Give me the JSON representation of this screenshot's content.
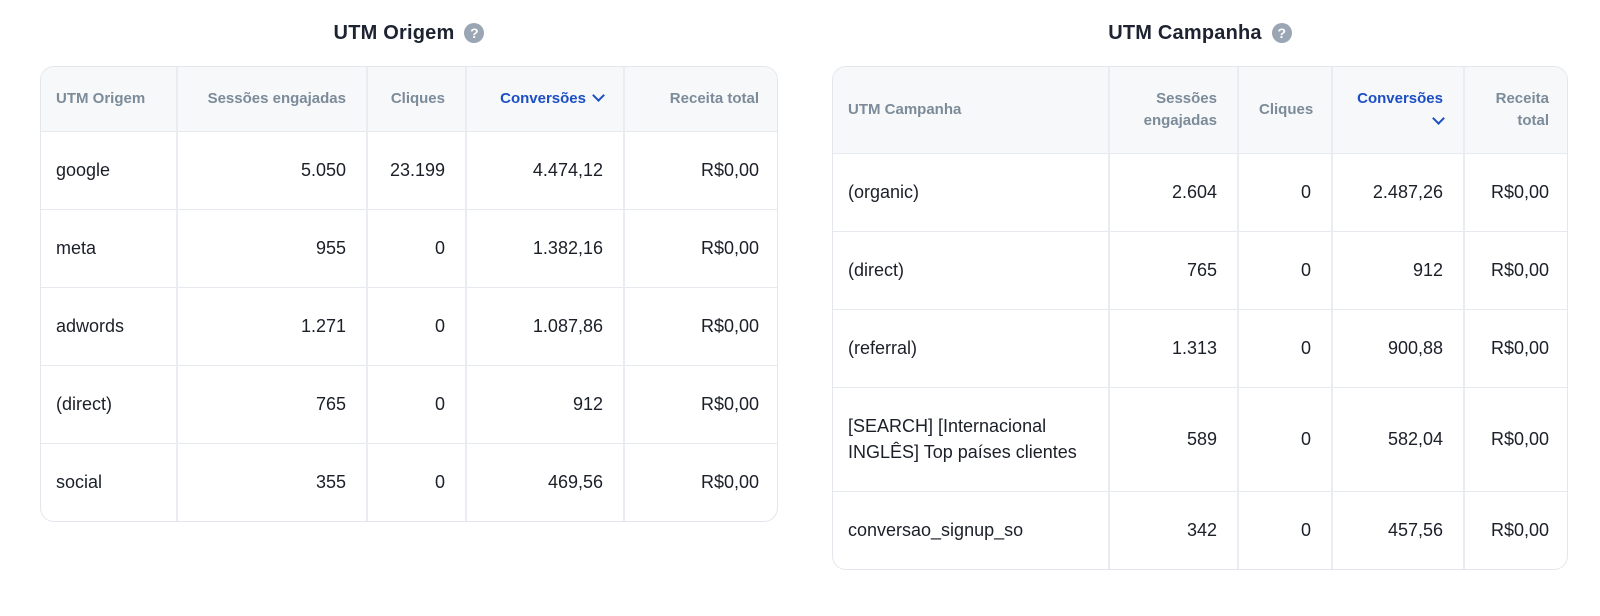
{
  "origem": {
    "title": "UTM Origem",
    "help_glyph": "?",
    "columns": [
      "UTM Origem",
      "Sessões engajadas",
      "Cliques",
      "Conversões",
      "Receita total"
    ],
    "rows": [
      [
        "google",
        "5.050",
        "23.199",
        "4.474,12",
        "R$0,00"
      ],
      [
        "meta",
        "955",
        "0",
        "1.382,16",
        "R$0,00"
      ],
      [
        "adwords",
        "1.271",
        "0",
        "1.087,86",
        "R$0,00"
      ],
      [
        "(direct)",
        "765",
        "0",
        "912",
        "R$0,00"
      ],
      [
        "social",
        "355",
        "0",
        "469,56",
        "R$0,00"
      ]
    ]
  },
  "campanha": {
    "title": "UTM Campanha",
    "help_glyph": "?",
    "columns": [
      "UTM Campanha",
      "Sessões engajadas",
      "Cliques",
      "Conversões",
      "Receita total"
    ],
    "rows": [
      [
        "(organic)",
        "2.604",
        "0",
        "2.487,26",
        "R$0,00"
      ],
      [
        "(direct)",
        "765",
        "0",
        "912",
        "R$0,00"
      ],
      [
        "(referral)",
        "1.313",
        "0",
        "900,88",
        "R$0,00"
      ],
      [
        "[SEARCH] [Internacional INGLÊS] Top países clientes",
        "589",
        "0",
        "582,04",
        "R$0,00"
      ],
      [
        "conversao_signup_so",
        "342",
        "0",
        "457,56",
        "R$0,00"
      ]
    ]
  },
  "sort_icon": "chevron-down-icon",
  "colors": {
    "sorted_header": "#1d4fc4",
    "header_text": "#7c8b99",
    "header_bg": "#f6f8fa",
    "help_icon_bg": "#9aa6b3"
  }
}
